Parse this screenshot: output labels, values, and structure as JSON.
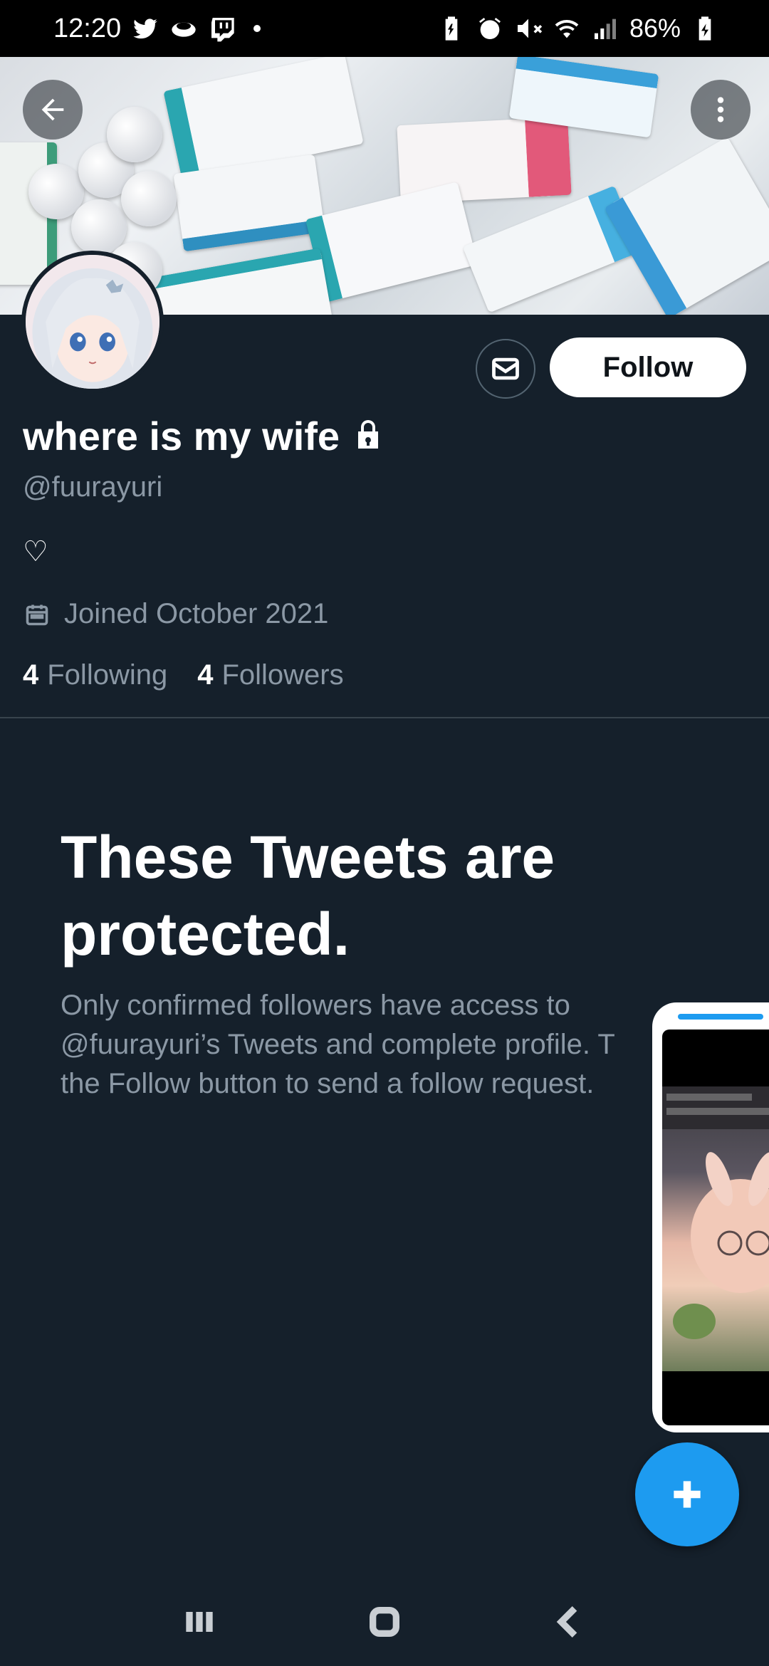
{
  "status_bar": {
    "time": "12:20",
    "left_icons": [
      "twitter-icon",
      "cloud-app-icon",
      "twitch-icon"
    ],
    "right_icons": [
      "battery-saver-icon",
      "alarm-icon",
      "mute-icon",
      "wifi-icon",
      "signal-icon"
    ],
    "battery": "86%"
  },
  "header": {
    "back_icon": "arrow-left-icon",
    "more_icon": "more-vertical-icon"
  },
  "profile": {
    "display_name": "where is my wife",
    "handle": "@fuurayuri",
    "bio": "♡",
    "joined": "Joined October 2021",
    "following_count": "4",
    "following_label": "Following",
    "followers_count": "4",
    "followers_label": "Followers",
    "follow_button": "Follow"
  },
  "protected": {
    "title": "These Tweets are protected.",
    "body": "Only confirmed followers have access to\n@fuurayuri’s Tweets and complete profile. T\nthe Follow button to send a follow request."
  },
  "colors": {
    "background": "#15202b",
    "accent": "#1d9bf0",
    "muted_text": "#8b98a5",
    "divider": "#38444d"
  }
}
